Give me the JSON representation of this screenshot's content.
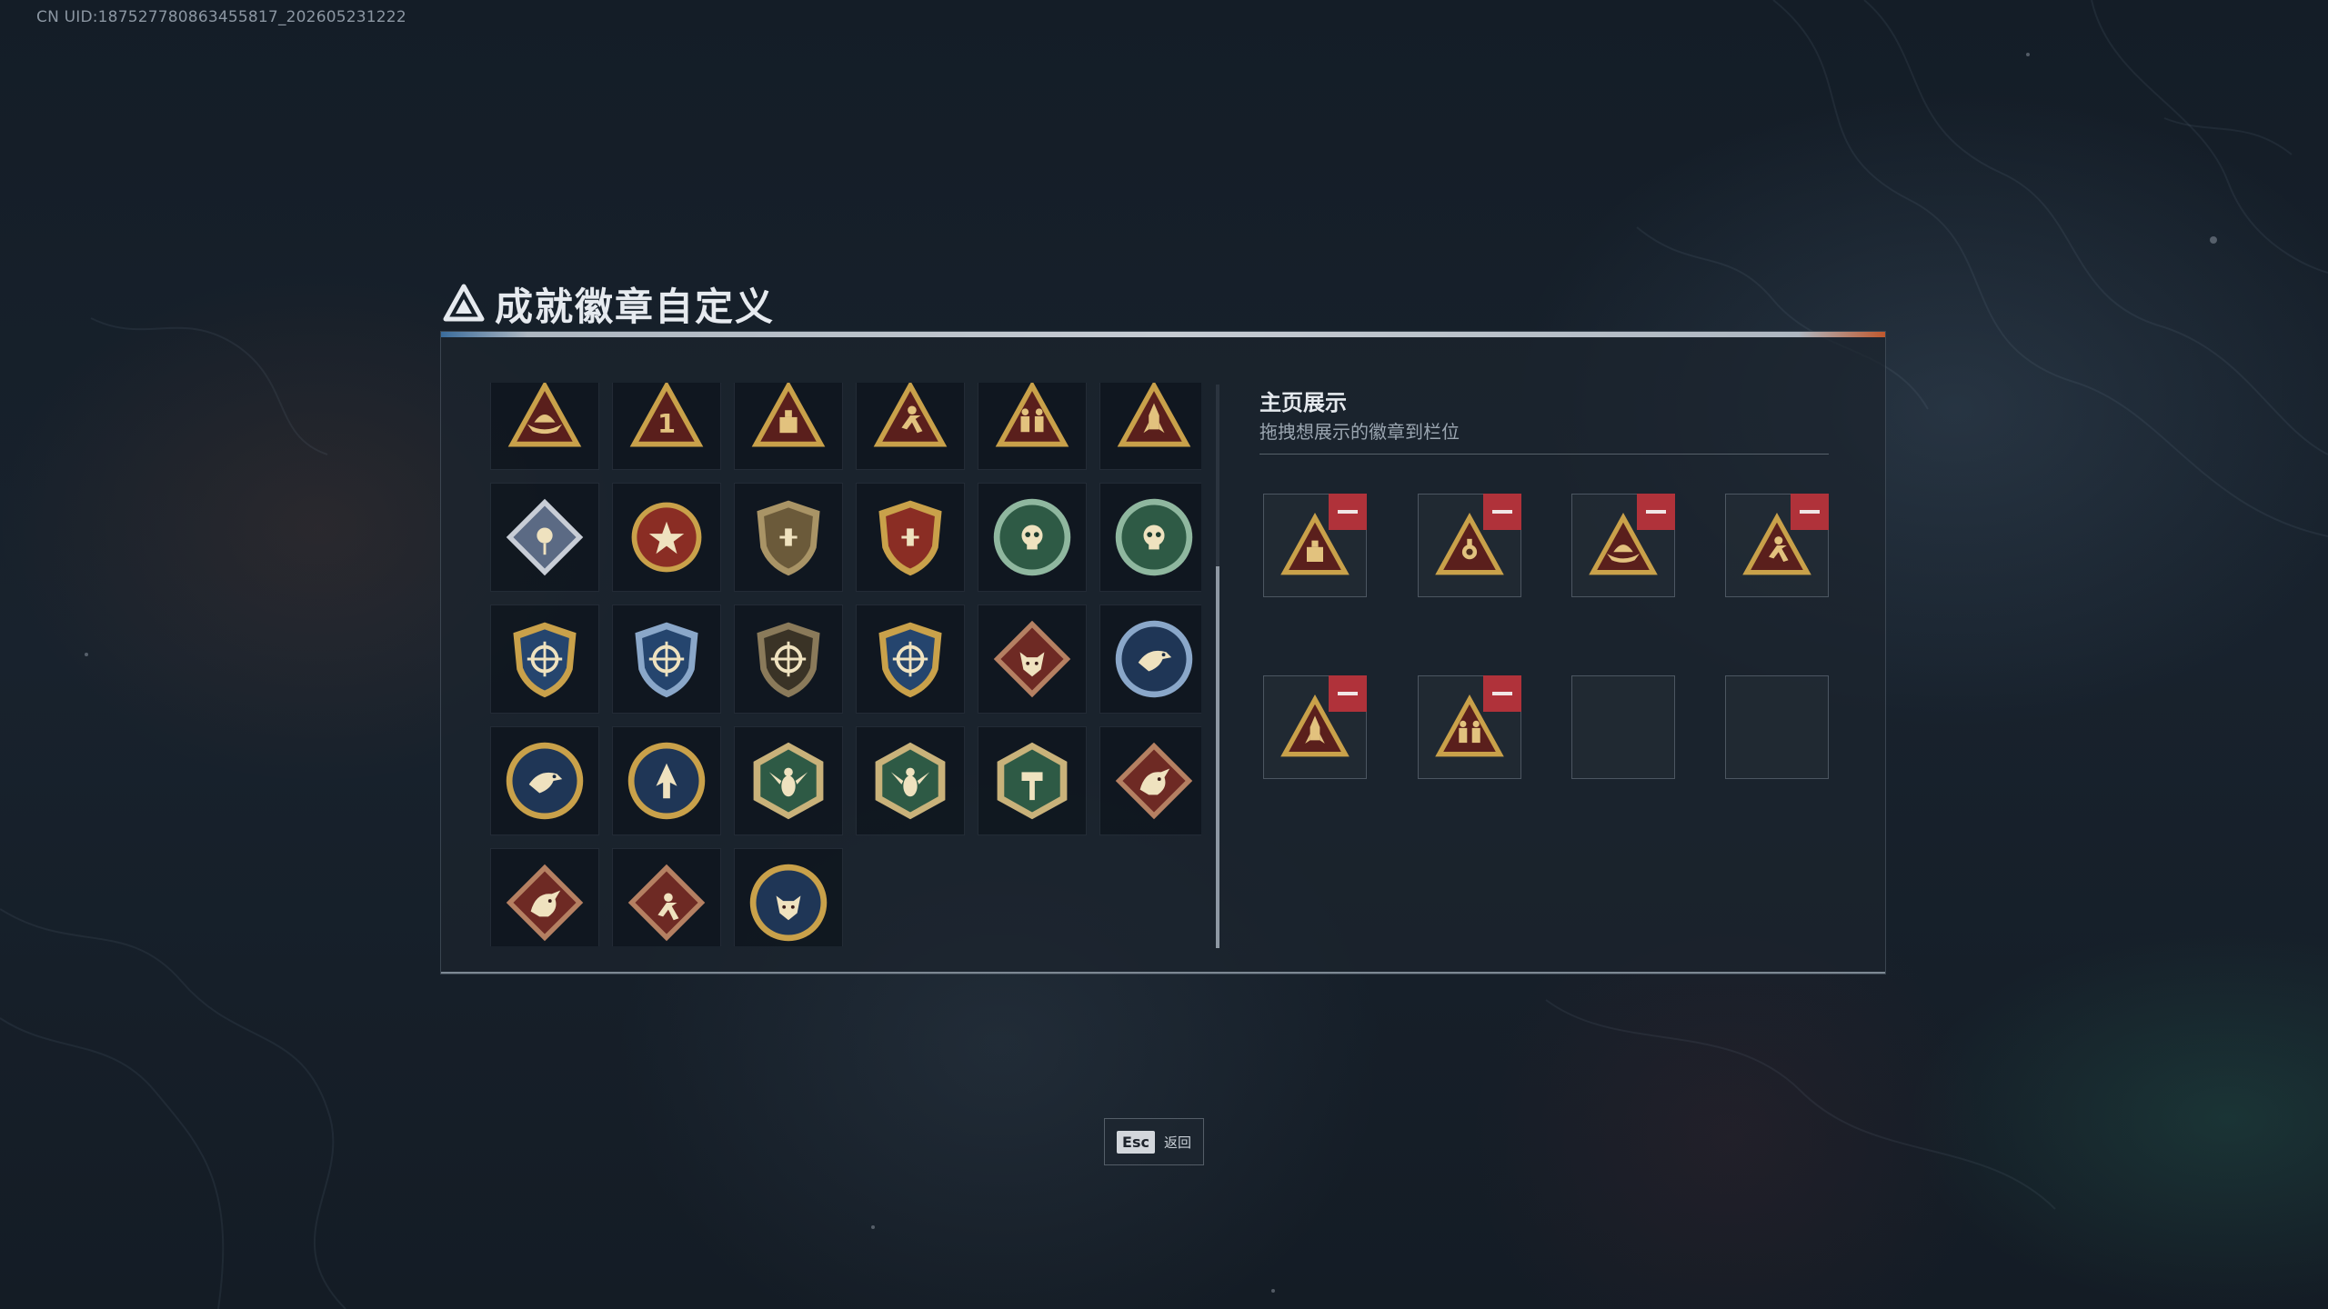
{
  "uid_watermark": "CN UID:1875277808634558​17_202605231222",
  "title": "成就徽章自定义",
  "showcase": {
    "title": "主页展示",
    "subtitle": "拖拽想展示的徽章到栏位"
  },
  "footer": {
    "esc_key": "Esc",
    "esc_label": "返回"
  },
  "palette": {
    "gold": "#c9a14a",
    "dark_red": "#5a1f1c",
    "remove_red": "#b0323a",
    "blue": "#25456e",
    "green": "#2e5a45"
  },
  "badges": [
    {
      "icon": "triangle-boat-badge-icon",
      "new": true
    },
    {
      "icon": "triangle-number-one-badge-icon",
      "new": false
    },
    {
      "icon": "triangle-box-badge-icon",
      "new": true
    },
    {
      "icon": "triangle-runner-badge-icon",
      "new": true
    },
    {
      "icon": "triangle-soldiers-badge-icon",
      "new": true
    },
    {
      "icon": "triangle-rocket-badge-icon",
      "new": true
    },
    {
      "icon": "diamond-rose-badge-icon"
    },
    {
      "icon": "star-medal-badge-icon"
    },
    {
      "icon": "shield-crest-badge-icon"
    },
    {
      "icon": "starred-crest-badge-icon"
    },
    {
      "icon": "green-crosshair-skull-badge-icon"
    },
    {
      "icon": "green-laurel-skull-badge-icon"
    },
    {
      "icon": "gold-crosshair-shield-badge-icon"
    },
    {
      "icon": "blue-crosshair-shield-badge-icon"
    },
    {
      "icon": "bronze-crosshair-shield-badge-icon"
    },
    {
      "icon": "gold-crosshair-shield-2-badge-icon"
    },
    {
      "icon": "red-wolf-diamond-badge-icon"
    },
    {
      "icon": "blue-eagle-circle-badge-icon"
    },
    {
      "icon": "blue-eagle-circle-2-badge-icon"
    },
    {
      "icon": "blue-arrow-circle-badge-icon"
    },
    {
      "icon": "green-wasp-hexagon-badge-icon"
    },
    {
      "icon": "green-wasp-hexagon-2-badge-icon"
    },
    {
      "icon": "green-hammer-hexagon-badge-icon"
    },
    {
      "icon": "red-dragon-diamond-badge-icon"
    },
    {
      "icon": "red-dragon-diamond-2-badge-icon"
    },
    {
      "icon": "red-runner-diamond-badge-icon"
    },
    {
      "icon": "blue-wolf-circle-badge-icon"
    }
  ],
  "slots": [
    {
      "icon": "triangle-box-badge-icon",
      "filled": true
    },
    {
      "icon": "triangle-gear-badge-icon",
      "filled": true
    },
    {
      "icon": "triangle-boat-badge-icon",
      "filled": true
    },
    {
      "icon": "triangle-runner-badge-icon",
      "filled": true
    },
    {
      "icon": "triangle-rocket-badge-icon",
      "filled": true
    },
    {
      "icon": "triangle-soldiers-badge-icon",
      "filled": true
    },
    {
      "icon": "",
      "filled": false
    },
    {
      "icon": "",
      "filled": false
    }
  ]
}
